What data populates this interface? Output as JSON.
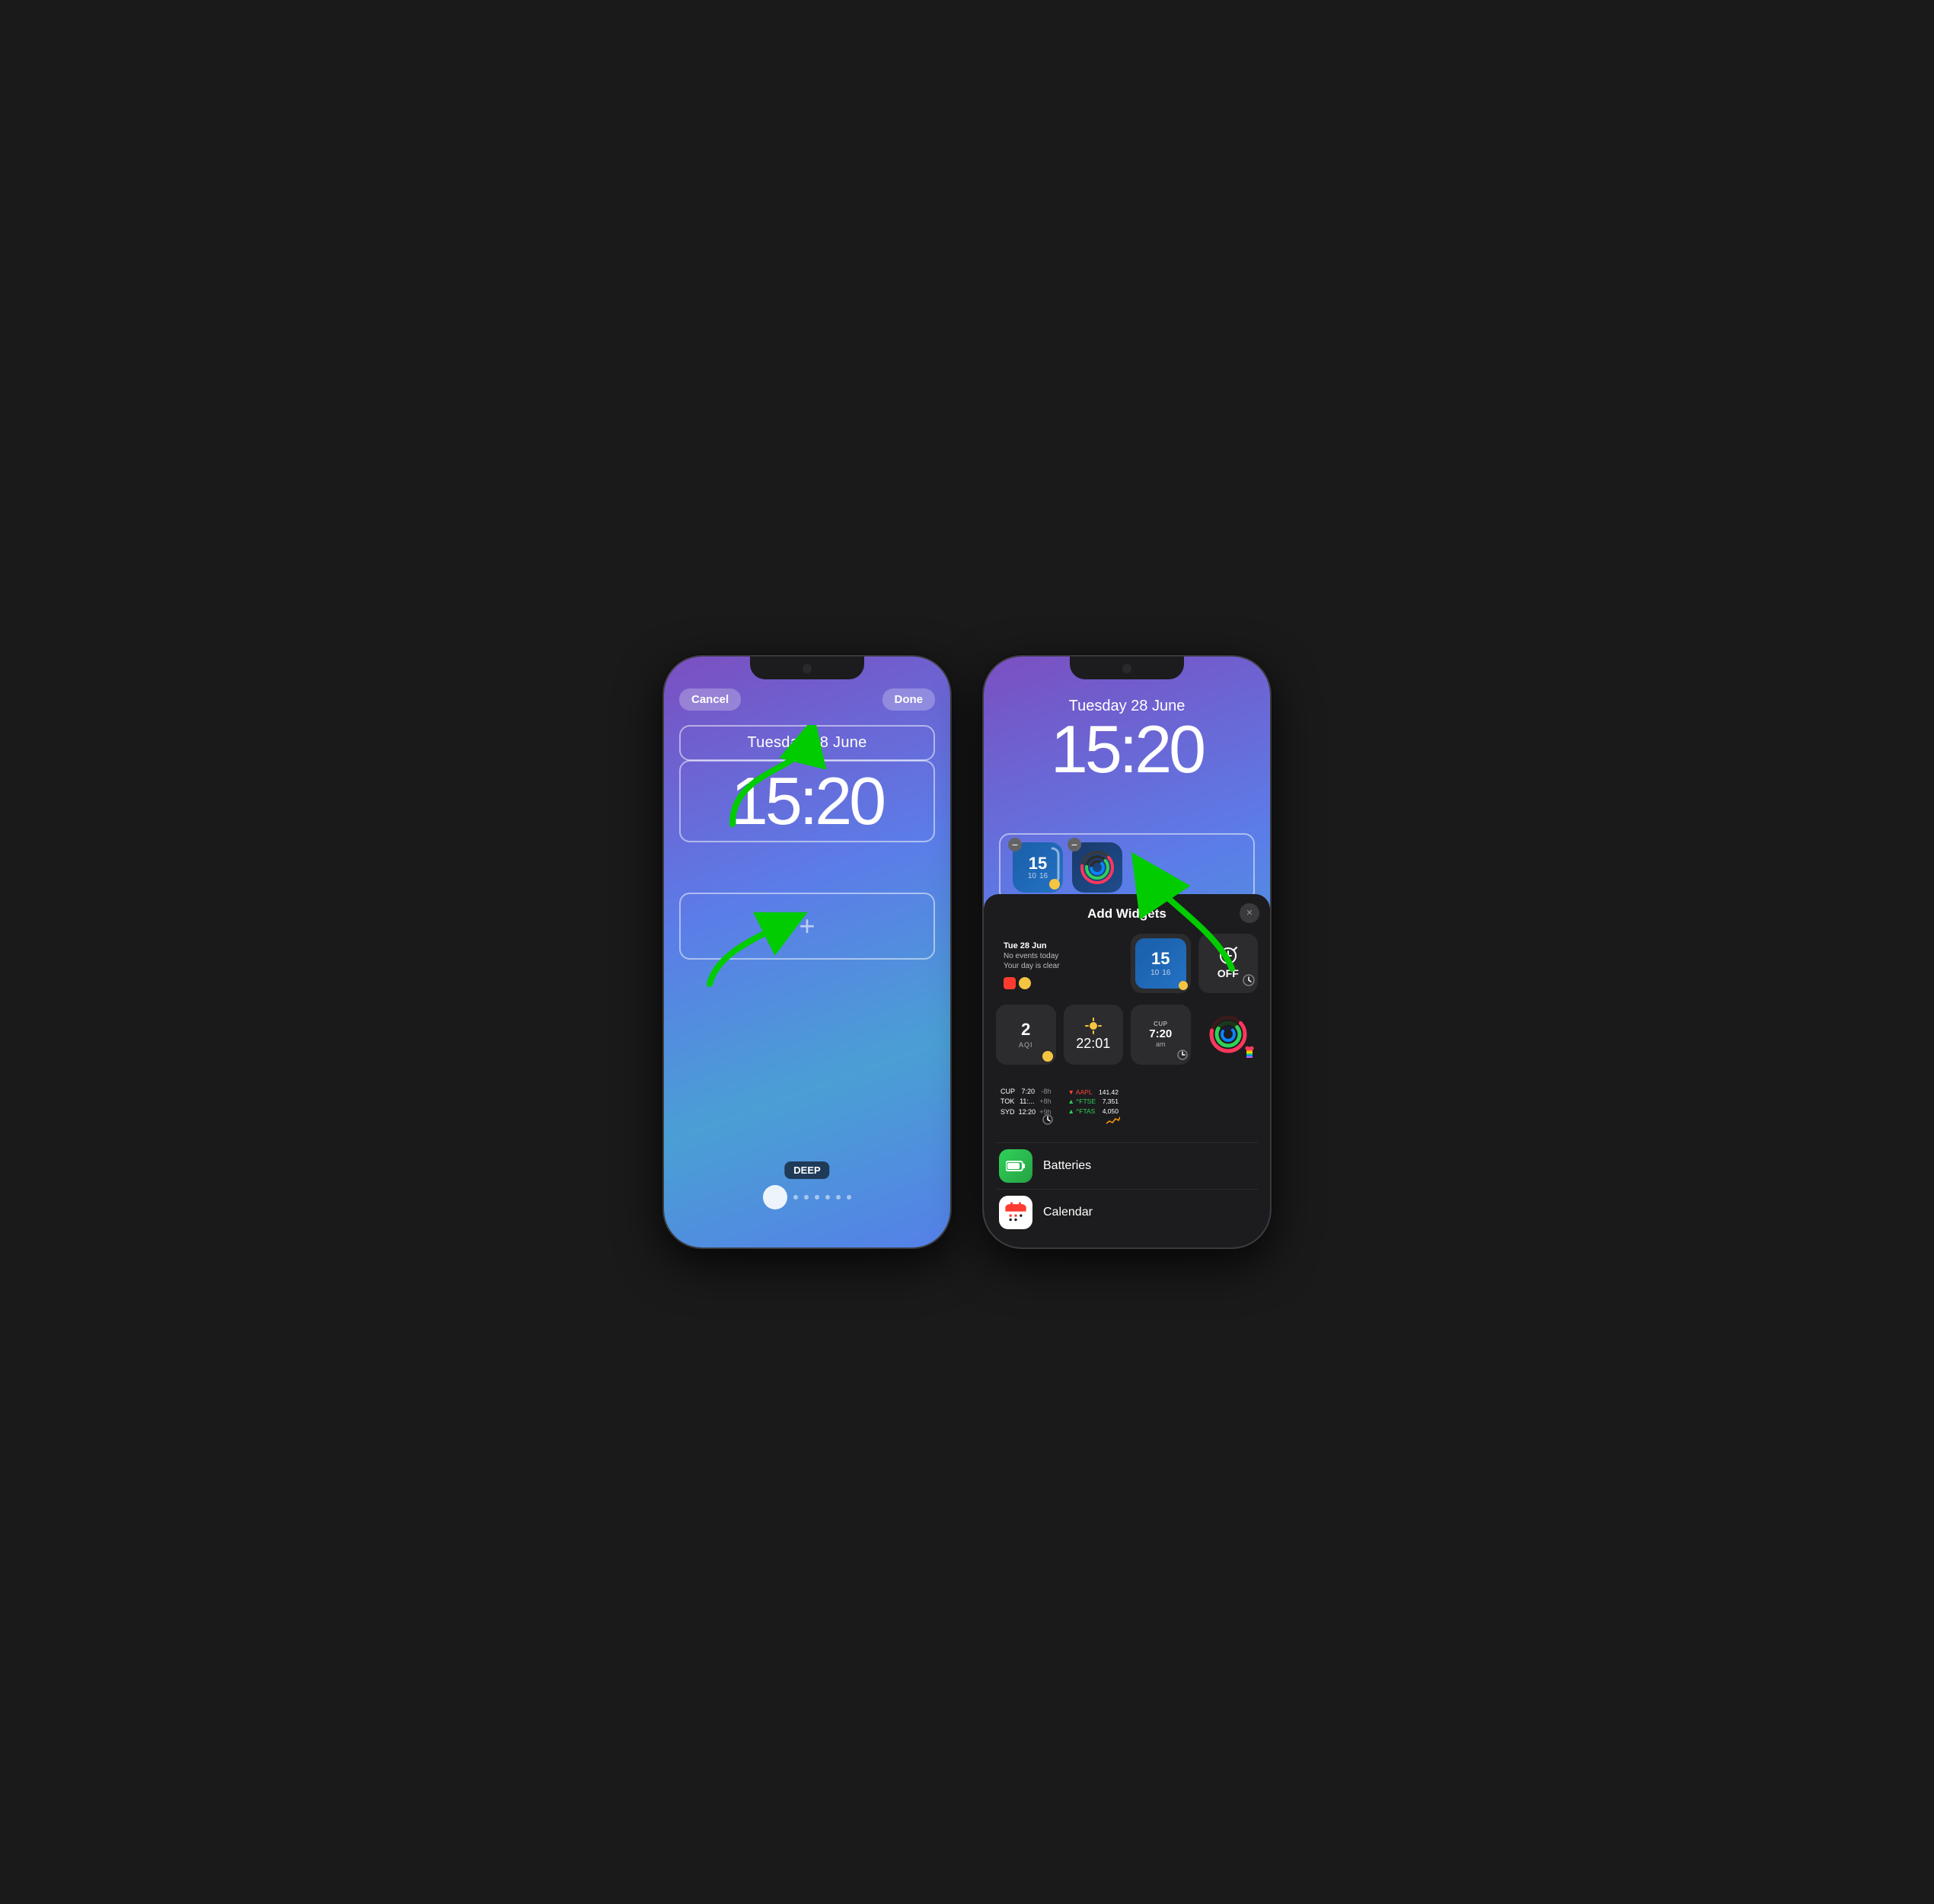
{
  "scene": {
    "title": "iOS Lock Screen Widget Editor"
  },
  "phone1": {
    "cancel_label": "Cancel",
    "done_label": "Done",
    "date": "Tuesday 28 June",
    "time": "15:20",
    "add_plus": "+",
    "wallpaper_label": "DEEP",
    "topbar": {
      "cancel": "Cancel",
      "done": "Done"
    }
  },
  "phone2": {
    "date": "Tuesday 28 June",
    "time": "15:20",
    "panel": {
      "title": "Add Widgets",
      "close_label": "×"
    },
    "widget1": {
      "num": "15",
      "sub1": "10",
      "sub2": "16"
    },
    "widget_calendar": {
      "date": "Tue 28 Jun",
      "line1": "No events today",
      "line2": "Your day is clear"
    },
    "widget_aqi": {
      "num": "2",
      "label": "AQI"
    },
    "widget_time2": {
      "time": "22:01"
    },
    "widget_cup": {
      "label": "CUP",
      "time": "7:20",
      "period": "am"
    },
    "widget_off": {
      "label": "OFF"
    },
    "worldclock": {
      "rows": [
        {
          "city": "CUP",
          "time": "7:20",
          "offset": "-8h"
        },
        {
          "city": "TOK",
          "time": "11:...",
          "offset": "+8h"
        },
        {
          "city": "SYD",
          "time": "12:20",
          "offset": "+9h"
        }
      ]
    },
    "stocks": {
      "rows": [
        {
          "name": "▼ AAPL",
          "value": "141.42",
          "dir": "down"
        },
        {
          "name": "▲ ^FTSE",
          "value": "7,351",
          "dir": "up"
        },
        {
          "name": "▲ ^FTAS",
          "value": "4,050",
          "dir": "up"
        }
      ]
    },
    "batteries_app": {
      "name": "Batteries"
    },
    "calendar_app": {
      "name": "Calendar"
    }
  }
}
